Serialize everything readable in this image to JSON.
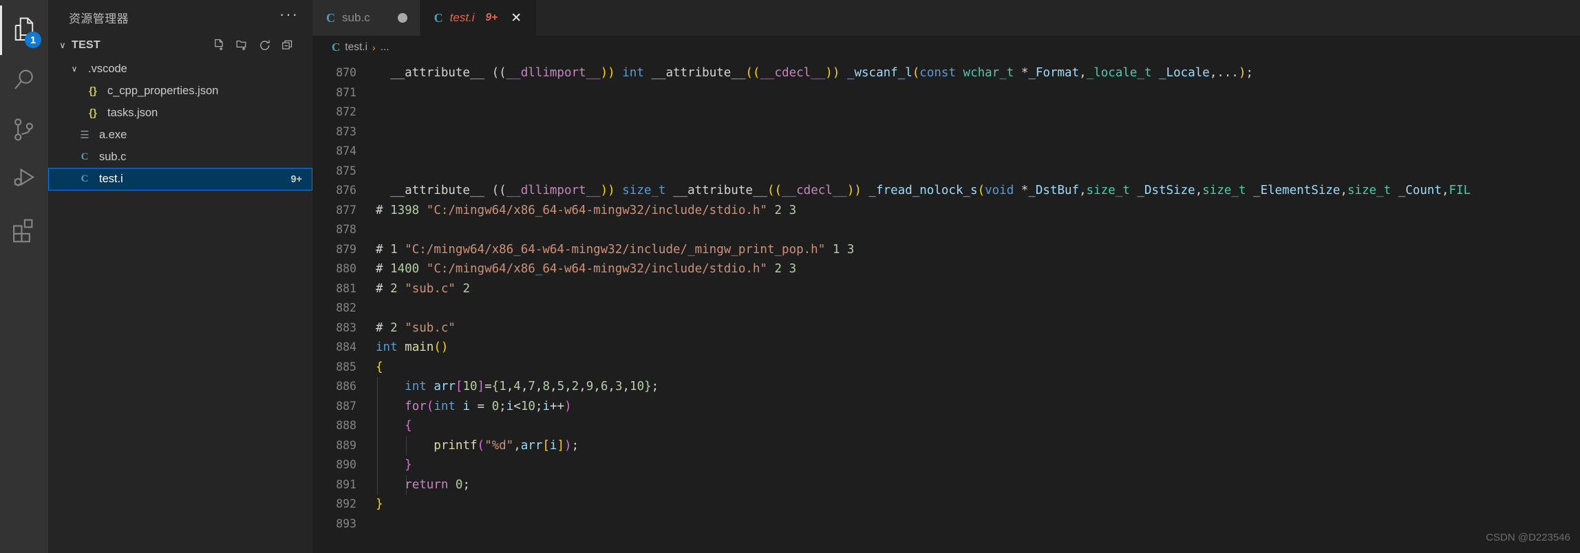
{
  "activitybar": {
    "items": [
      {
        "name": "explorer",
        "icon": "files-icon",
        "active": true,
        "badge": "1"
      },
      {
        "name": "search",
        "icon": "search-icon",
        "active": false,
        "badge": ""
      },
      {
        "name": "source-control",
        "icon": "source-control-icon",
        "active": false,
        "badge": ""
      },
      {
        "name": "run-and-debug",
        "icon": "run-debug-icon",
        "active": false,
        "badge": ""
      },
      {
        "name": "extensions",
        "icon": "extensions-icon",
        "active": false,
        "badge": ""
      }
    ]
  },
  "sidebar": {
    "title": "资源管理器",
    "more_actions": "···",
    "section": {
      "label": "TEST",
      "twisty": "∨",
      "actions": [
        "new-file-icon",
        "new-folder-icon",
        "refresh-icon",
        "collapse-all-icon"
      ]
    },
    "tree": [
      {
        "label": ".vscode",
        "icon": "folder-icon",
        "twisty": "∨",
        "indent": 1,
        "badge": "",
        "selected": false,
        "icon_class": ""
      },
      {
        "label": "c_cpp_properties.json",
        "icon": "json-icon",
        "twisty": "",
        "indent": 2,
        "badge": "",
        "selected": false,
        "icon_class": "ic-json",
        "glyph": "{}"
      },
      {
        "label": "tasks.json",
        "icon": "json-icon",
        "twisty": "",
        "indent": 2,
        "badge": "",
        "selected": false,
        "icon_class": "ic-json",
        "glyph": "{}"
      },
      {
        "label": "a.exe",
        "icon": "binary-icon",
        "twisty": "",
        "indent": 1,
        "badge": "",
        "selected": false,
        "icon_class": "ic-bin",
        "glyph": "☰"
      },
      {
        "label": "sub.c",
        "icon": "c-file-icon",
        "twisty": "",
        "indent": 1,
        "badge": "",
        "selected": false,
        "icon_class": "ic-c",
        "glyph": "C"
      },
      {
        "label": "test.i",
        "icon": "c-file-icon",
        "twisty": "",
        "indent": 1,
        "badge": "9+",
        "selected": true,
        "icon_class": "ic-c",
        "glyph": "C"
      }
    ]
  },
  "tabs": [
    {
      "name": "sub.c",
      "icon": "c-file-icon",
      "active": false,
      "dirty": true,
      "badge": "",
      "close": ""
    },
    {
      "name": "test.i",
      "icon": "c-file-icon",
      "active": true,
      "dirty": false,
      "badge": "9+",
      "close": "✕"
    }
  ],
  "breadcrumb": {
    "file_icon": "c-file-icon",
    "file": "test.i",
    "separator": "›",
    "tail": "..."
  },
  "editor": {
    "first_line": 870,
    "lines": [
      {
        "n": 870,
        "text": "  __attribute__ ((__dllimport__)) int __attribute__((__cdecl__)) _wscanf_l(const wchar_t *_Format,_locale_t _Locale,...);"
      },
      {
        "n": 871,
        "text": ""
      },
      {
        "n": 872,
        "text": ""
      },
      {
        "n": 873,
        "text": ""
      },
      {
        "n": 874,
        "text": ""
      },
      {
        "n": 875,
        "text": ""
      },
      {
        "n": 876,
        "text": "  __attribute__ ((__dllimport__)) size_t __attribute__((__cdecl__)) _fread_nolock_s(void *_DstBuf,size_t _DstSize,size_t _ElementSize,size_t _Count,FIL"
      },
      {
        "n": 877,
        "text": "# 1398 \"C:/mingw64/x86_64-w64-mingw32/include/stdio.h\" 2 3"
      },
      {
        "n": 878,
        "text": ""
      },
      {
        "n": 879,
        "text": "# 1 \"C:/mingw64/x86_64-w64-mingw32/include/_mingw_print_pop.h\" 1 3"
      },
      {
        "n": 880,
        "text": "# 1400 \"C:/mingw64/x86_64-w64-mingw32/include/stdio.h\" 2 3"
      },
      {
        "n": 881,
        "text": "# 2 \"sub.c\" 2"
      },
      {
        "n": 882,
        "text": ""
      },
      {
        "n": 883,
        "text": "# 2 \"sub.c\""
      },
      {
        "n": 884,
        "text": "int main()"
      },
      {
        "n": 885,
        "text": "{"
      },
      {
        "n": 886,
        "text": "    int arr[10]={1,4,7,8,5,2,9,6,3,10};"
      },
      {
        "n": 887,
        "text": "    for(int i = 0;i<10;i++)"
      },
      {
        "n": 888,
        "text": "    {"
      },
      {
        "n": 889,
        "text": "        printf(\"%d\",arr[i]);"
      },
      {
        "n": 890,
        "text": "    }"
      },
      {
        "n": 891,
        "text": "    return 0;"
      },
      {
        "n": 892,
        "text": "}"
      },
      {
        "n": 893,
        "text": ""
      }
    ]
  },
  "watermark": "CSDN @D223546",
  "colors": {
    "accent": "#0e7ad4",
    "selection": "#04395e",
    "editor_bg": "#1e1e1e",
    "sidebar_bg": "#252526",
    "activitybar_bg": "#333333",
    "error_text": "#e2684a"
  }
}
